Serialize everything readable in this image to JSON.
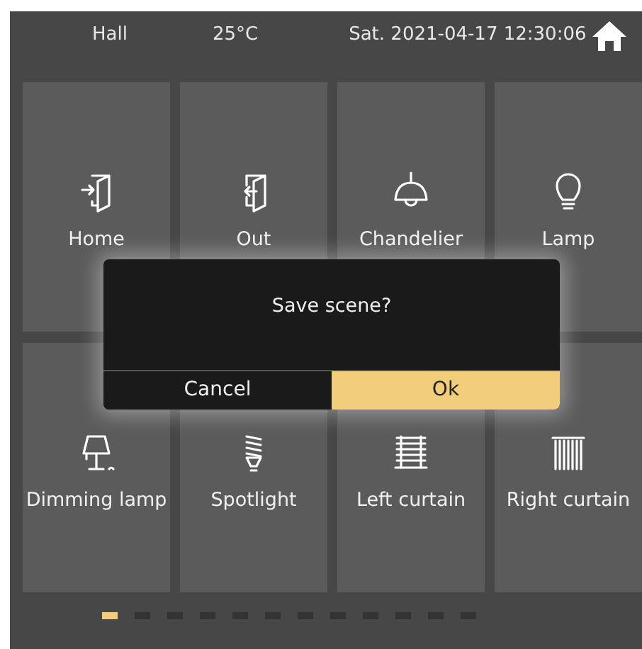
{
  "header": {
    "location": "Hall",
    "temperature": "25°C",
    "datetime": "Sat. 2021-04-17 12:30:06"
  },
  "tiles": [
    {
      "label": "Home",
      "kind": "enter"
    },
    {
      "label": "Out",
      "kind": "exit"
    },
    {
      "label": "Chandelier",
      "kind": "pendant"
    },
    {
      "label": "Lamp",
      "kind": "bulb"
    },
    {
      "label": "Dimming lamp",
      "kind": "table-lamp"
    },
    {
      "label": "Spotlight",
      "kind": "spiral-bulb"
    },
    {
      "label": "Left curtain",
      "kind": "blinds"
    },
    {
      "label": "Right curtain",
      "kind": "vertical-blinds"
    }
  ],
  "dialog": {
    "message": "Save scene?",
    "buttons": [
      {
        "label": "Cancel",
        "selected": false
      },
      {
        "label": "Ok",
        "selected": true
      }
    ]
  },
  "pager": [
    {
      "selected": true
    },
    {
      "selected": false
    },
    {
      "selected": false
    },
    {
      "selected": false
    },
    {
      "selected": false
    },
    {
      "selected": false
    },
    {
      "selected": false
    },
    {
      "selected": false
    },
    {
      "selected": false
    },
    {
      "selected": false
    },
    {
      "selected": false
    },
    {
      "selected": false
    }
  ]
}
